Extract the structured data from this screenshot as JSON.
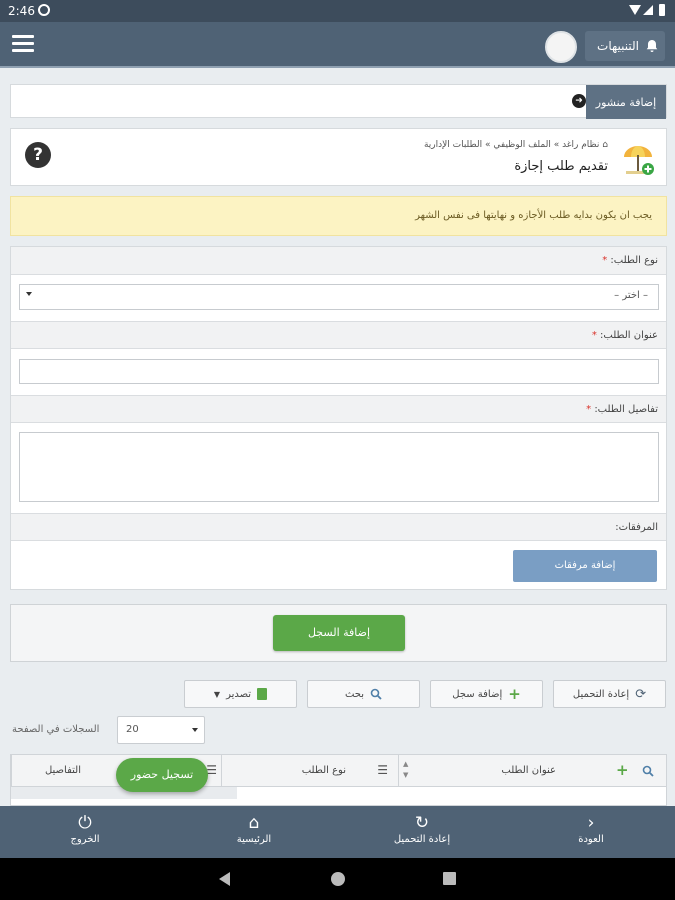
{
  "status_bar": {
    "time": "2:46"
  },
  "top_bar": {
    "notifications_label": "التنبيهات"
  },
  "post_bar": {
    "add_post_label": "إضافة منشور"
  },
  "header": {
    "breadcrumb": [
      "نظام راغد",
      "الملف الوظيفي",
      "الطلبات الإدارية"
    ],
    "title": "تقديم طلب إجازة"
  },
  "alert": {
    "text": "يجب ان يكون بدايه طلب الأجازه و نهايتها فى نفس الشهر"
  },
  "form": {
    "request_type_label": "نوع الطلب:",
    "request_type_value": "– اختر –",
    "request_title_label": "عنوان الطلب:",
    "request_details_label": "تفاصيل الطلب:",
    "attachments_label": "المرفقات:",
    "add_attachments_label": "إضافة مرفقات",
    "required_mark": "*"
  },
  "save": {
    "add_record_label": "إضافة السجل"
  },
  "toolbar": {
    "reload_label": "إعادة التحميل",
    "add_record_label": "إضافة سجل",
    "search_label": "بحث",
    "export_label": "تصدير"
  },
  "pagination": {
    "per_page_label": "السجلات في الصفحة",
    "per_page_value": "20"
  },
  "table": {
    "columns": [
      "عنوان الطلب",
      "نوع الطلب",
      "التفاصيل"
    ]
  },
  "checkin": {
    "label": "تسجيل حضور"
  },
  "bottom_nav": {
    "back": "العودة",
    "reload": "إعادة التحميل",
    "home": "الرئيسية",
    "logout": "الخروج"
  },
  "colors": {
    "header_bg": "#4f6275",
    "success": "#5ba848",
    "alert_bg": "#fcf3c3",
    "attach_btn": "#7a9ec4"
  }
}
